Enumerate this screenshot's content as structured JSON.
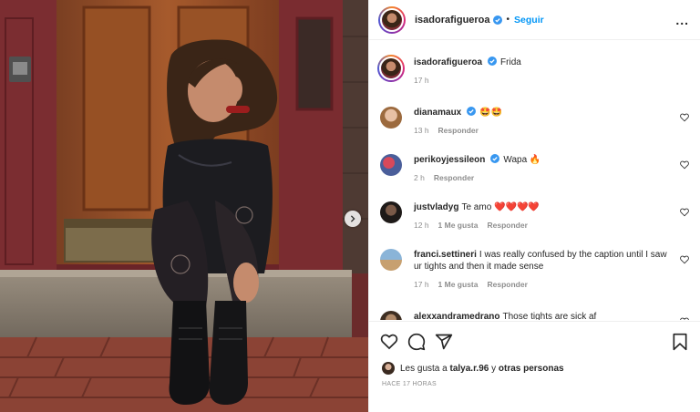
{
  "header": {
    "username": "isadorafigueroa",
    "separator": "•",
    "follow_label": "Seguir",
    "more_label": "..."
  },
  "caption": {
    "username": "isadorafigueroa",
    "text": "Frida",
    "time": "17 h"
  },
  "comments": [
    {
      "username": "dianamaux",
      "verified": true,
      "text": "🤩🤩",
      "time": "13 h",
      "likes": "",
      "reply_label": "Responder"
    },
    {
      "username": "perikoyjessileon",
      "verified": true,
      "text": "Wapa 🔥",
      "time": "2 h",
      "likes": "",
      "reply_label": "Responder"
    },
    {
      "username": "justvladyg",
      "verified": false,
      "text": "Te amo ❤️❤️❤️❤️",
      "time": "12 h",
      "likes": "1 Me gusta",
      "reply_label": "Responder"
    },
    {
      "username": "franci.settineri",
      "verified": false,
      "text": "I was really confused by the caption until I saw ur tights and then it made sense",
      "time": "17 h",
      "likes": "1 Me gusta",
      "reply_label": "Responder"
    },
    {
      "username": "alexxandramedrano",
      "verified": false,
      "text": "Those tights are sick af",
      "time": "",
      "likes": "",
      "reply_label": ""
    }
  ],
  "likes": {
    "prefix": "Les gusta a",
    "user": "talya.r.96",
    "joiner": "y",
    "others": "otras personas"
  },
  "timestamp": "HACE 17 HORAS",
  "colors": {
    "accent": "#0095f6",
    "verified": "#3897f0",
    "muted": "#8e8e8e",
    "text": "#262626"
  },
  "icons": [
    "verified-badge-icon",
    "heart-icon",
    "comment-icon",
    "share-icon",
    "bookmark-icon",
    "more-options-icon",
    "next-arrow-icon"
  ]
}
